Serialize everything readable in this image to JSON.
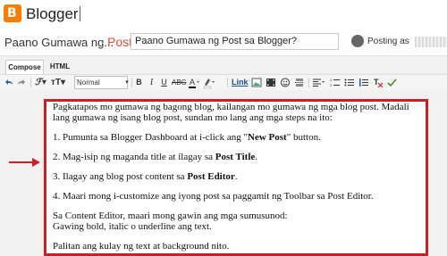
{
  "app": {
    "name": "Blogger"
  },
  "colors": {
    "brand": "#f57d00",
    "post_label": "#dd4b39",
    "highlight": "#cc1f24"
  },
  "postbar": {
    "blog_name": "Paano Gumawa ng...",
    "separator": "·",
    "post_label": "Post",
    "title_value": "Paano Gumawa ng Post sa Blogger?",
    "posting_as": "Posting as"
  },
  "tabs": [
    {
      "label": "Compose"
    },
    {
      "label": "HTML"
    }
  ],
  "toolbar": {
    "font_size_select": "Normal",
    "link_label": "Link",
    "icons": [
      "undo-icon",
      "redo-icon",
      "font-family-icon",
      "font-size-icon",
      "bold-icon",
      "italic-icon",
      "underline-icon",
      "strikethrough-icon",
      "text-color-icon",
      "highlight-color-icon",
      "image-icon",
      "video-icon",
      "emoji-icon",
      "jump-break-icon",
      "align-icon",
      "numbered-list-icon",
      "bulleted-list-icon",
      "quote-icon",
      "clear-formatting-icon"
    ]
  },
  "content": {
    "p1": "Pagkatapos mo gumawa ng bagong blog, kailangan mo gumawa ng mga blog post. Madali lang gumawa ng isang blog post, sundan mo lang ang mga steps na ito:",
    "p2_pre": "1. Pumunta sa Blogger Dashboard at i-click ang \"",
    "p2_bold": "New Post",
    "p2_post": "\" button.",
    "p3_pre": "2. Mag-isip ng maganda title at ilagay sa ",
    "p3_bold": "Post Title",
    "p3_post": ".",
    "p4_pre": "3. Ilagay ang blog post content sa ",
    "p4_bold": "Post Editor",
    "p4_post": ".",
    "p5": "4. Maari mong i-customize ang iyong post sa paggamit ng Toolbar sa Post Editor.",
    "p6_line1": "Sa Content Editor, maari mong gawin ang mga sumusunod:",
    "p6_line2": "Gawing bold, italic o underline ang text.",
    "p7": "Palitan ang kulay ng text at background nito."
  }
}
